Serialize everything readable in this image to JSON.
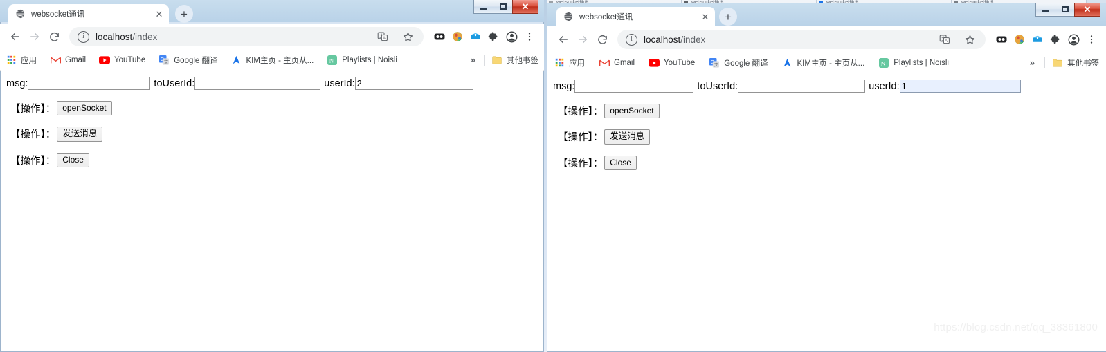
{
  "desktop": {
    "background_tabs": [
      {
        "title": "websocket通讯",
        "favicon_color": "#9aa0a6"
      },
      {
        "title": "websocket通讯",
        "favicon_color": "#5f6368"
      },
      {
        "title": "websocket通讯",
        "favicon_color": "#1a73e8"
      },
      {
        "title": "websocket通讯",
        "favicon_color": "#7a7f85"
      }
    ],
    "watermark": "https://blog.csdn.net/qq_38361800"
  },
  "window_controls": {
    "minimize_label": "Minimize",
    "maximize_label": "Maximize",
    "close_label": "✕"
  },
  "browser": {
    "tab": {
      "title": "websocket通讯",
      "close_label": "✕",
      "favicon": "globe-icon"
    },
    "new_tab_label": "+",
    "nav": {
      "back_label": "←",
      "forward_label": "→",
      "reload_label": "⟳"
    },
    "omnibox": {
      "info_label": "i",
      "host": "localhost",
      "path": "/index",
      "translate_icon": "translate-icon",
      "bookmark_icon": "star-icon"
    },
    "toolbar_icons": [
      {
        "name": "extension-dark-icon"
      },
      {
        "name": "idm-globe-icon"
      },
      {
        "name": "mailbox-extension-icon"
      },
      {
        "name": "puzzle-extensions-icon"
      },
      {
        "name": "profile-avatar-icon"
      },
      {
        "name": "chrome-menu-icon"
      }
    ],
    "bookmarks": [
      {
        "label": "应用",
        "icon": "apps-grid-icon"
      },
      {
        "label": "Gmail",
        "icon": "gmail-icon"
      },
      {
        "label": "YouTube",
        "icon": "youtube-icon"
      },
      {
        "label": "Google 翻译",
        "icon": "google-translate-icon"
      },
      {
        "label": "KIM主页 - 主页从...",
        "icon": "kim-icon"
      },
      {
        "label": "Playlists | Noisli",
        "icon": "noisli-icon"
      }
    ],
    "bookmarks_overflow_label": "»",
    "other_bookmarks": {
      "label": "其他书签",
      "icon": "folder-icon"
    }
  },
  "page": {
    "fields": [
      {
        "label": "msg:",
        "value": "",
        "name": "msg-input"
      },
      {
        "label": "toUserId:",
        "value": "",
        "name": "touserid-input"
      },
      {
        "label": "userId:",
        "value": "",
        "name": "userid-input"
      }
    ],
    "operations": [
      {
        "label": "【操作】：",
        "button": "openSocket"
      },
      {
        "label": "【操作】：",
        "button": "发送消息"
      },
      {
        "label": "【操作】：",
        "button": "Close"
      }
    ]
  },
  "windows": {
    "left": {
      "name": "chrome-window-left",
      "userid_value": "2",
      "userid_focused": false
    },
    "right": {
      "name": "chrome-window-right",
      "userid_value": "1",
      "userid_focused": true
    }
  }
}
